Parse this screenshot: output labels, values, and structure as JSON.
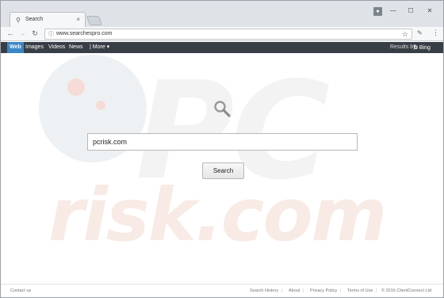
{
  "browser": {
    "tab_title": "Search",
    "tab_close": "×",
    "url": "www.searchespro.com",
    "profile_icon": "person-icon",
    "window_controls": {
      "minimize": "—",
      "maximize": "☐",
      "close": "✕"
    },
    "nav": {
      "back": "←",
      "forward": "→",
      "reload": "C"
    },
    "star": "☆",
    "menu": "⋮"
  },
  "site_nav": {
    "items": [
      "Web",
      "Images",
      "Videos",
      "News",
      "| More ▾"
    ],
    "active": "Web",
    "results_by": "Results by",
    "bing_logo_letter": "b",
    "bing_label": "Bing",
    "active_color": "#3b86c6",
    "bar_color": "#383e45"
  },
  "watermark": {
    "top": "PC",
    "bottom": "risk.com"
  },
  "search": {
    "value": "pcrisk.com",
    "button_label": "Search"
  },
  "footer": {
    "contact": "Contact us",
    "links": [
      "Search History",
      "About",
      "Privacy Policy",
      "Terms of Use"
    ],
    "separator": "|",
    "copyright": "© 2016 ClientConnect Ltd"
  }
}
